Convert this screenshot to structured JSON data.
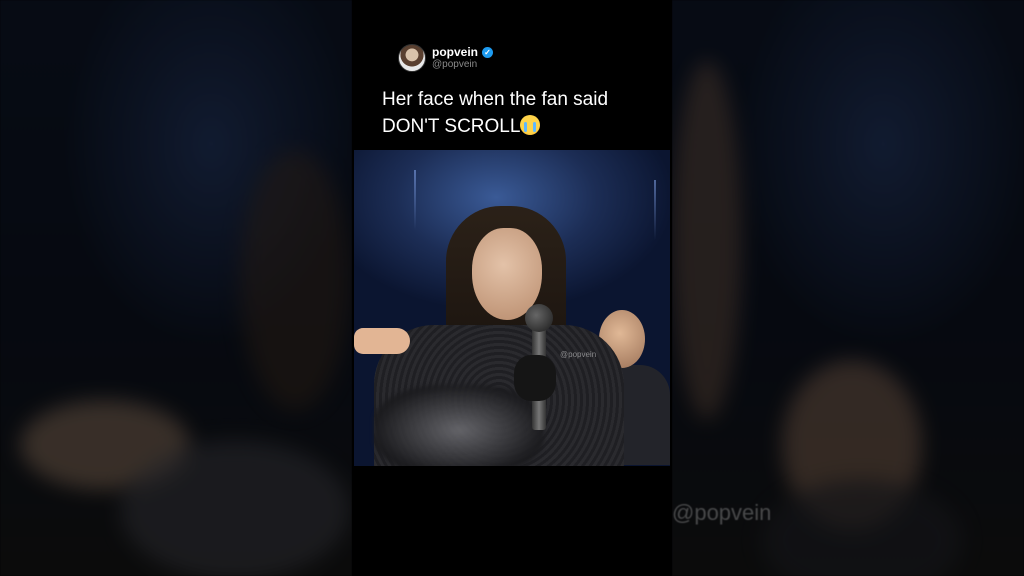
{
  "post": {
    "display_name": "popvein",
    "handle": "@popvein",
    "verified_icon": "verified-badge-icon",
    "caption_line1": "Her face when the fan said",
    "caption_line2": "DON'T SCROLL",
    "caption_emoji": "loudly-crying-face-emoji"
  },
  "video": {
    "watermark": "@popvein"
  },
  "background": {
    "watermark": "@popvein"
  },
  "colors": {
    "background": "#000000",
    "verified": "#1d9bf0",
    "handle": "#8a8a8a",
    "caption": "#ffffff"
  }
}
